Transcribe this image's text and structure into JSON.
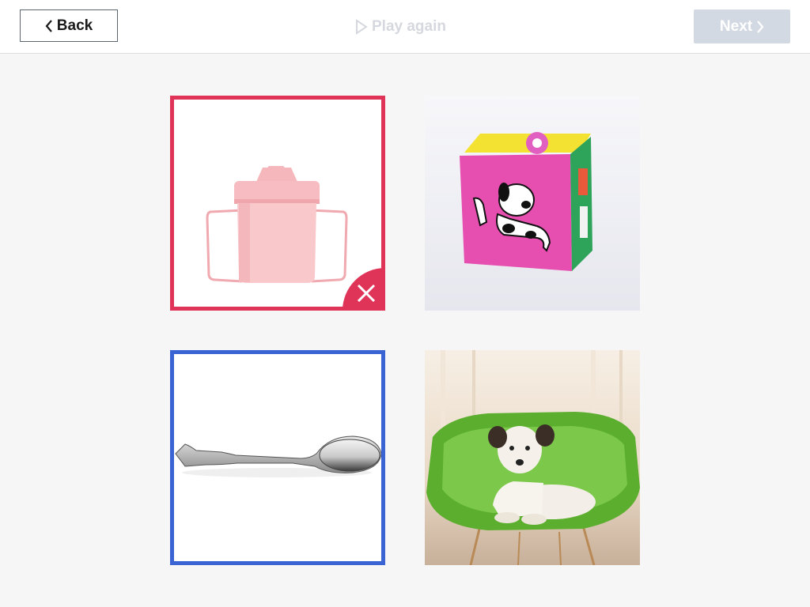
{
  "toolbar": {
    "back_label": "Back",
    "play_again_label": "Play again",
    "next_label": "Next"
  },
  "colors": {
    "wrong": "#e03358",
    "selected": "#3a63d3",
    "disabled": "#d3d9e2"
  },
  "cards": [
    {
      "subject": "pink sippy cup",
      "state": "wrong",
      "icon": "close-icon"
    },
    {
      "subject": "pink toy cube with dog",
      "state": "none"
    },
    {
      "subject": "silver spoon",
      "state": "selected"
    },
    {
      "subject": "dog on green chair",
      "state": "none"
    }
  ]
}
